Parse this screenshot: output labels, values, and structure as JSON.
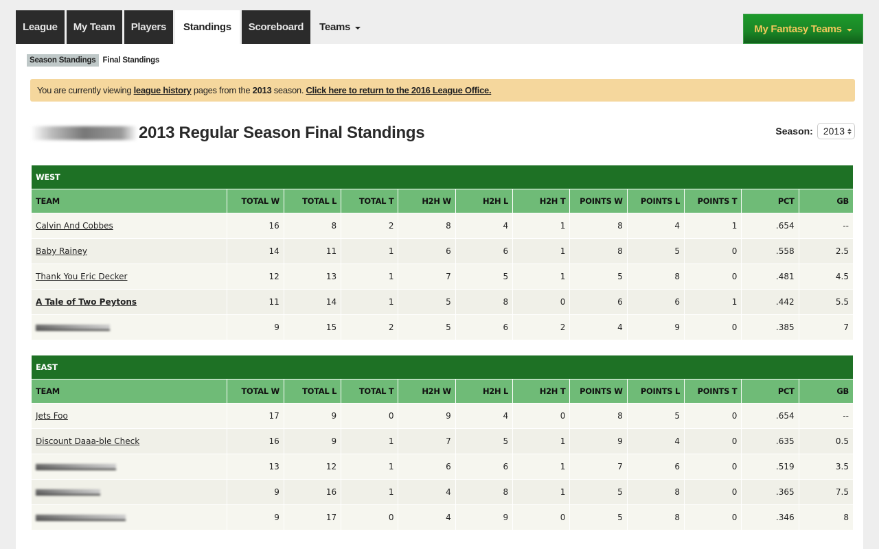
{
  "nav": {
    "tabs": [
      {
        "label": "League",
        "active": false
      },
      {
        "label": "My Team",
        "active": false
      },
      {
        "label": "Players",
        "active": false
      },
      {
        "label": "Standings",
        "active": true
      },
      {
        "label": "Scoreboard",
        "active": false
      }
    ],
    "teams_menu": "Teams",
    "my_fantasy_teams": "My Fantasy Teams"
  },
  "subnav": {
    "season_standings": "Season Standings",
    "final_standings": "Final Standings"
  },
  "notice": {
    "prefix": "You are currently viewing ",
    "link1": "league history",
    "middle": " pages from the ",
    "year": "2013",
    "suffix": " season. ",
    "link2": "Click here to return to the 2016 League Office."
  },
  "header": {
    "title": "2013 Regular Season Final Standings",
    "season_label": "Season:",
    "season_value": "2013"
  },
  "columns": [
    "TEAM",
    "TOTAL W",
    "TOTAL L",
    "TOTAL T",
    "H2H W",
    "H2H L",
    "H2H T",
    "POINTS W",
    "POINTS L",
    "POINTS T",
    "PCT",
    "GB"
  ],
  "divisions": [
    {
      "name": "WEST",
      "rows": [
        {
          "team": "Calvin And Cobbes",
          "redacted": false,
          "bold": false,
          "values": [
            "16",
            "8",
            "2",
            "8",
            "4",
            "1",
            "8",
            "4",
            "1",
            ".654",
            "--"
          ]
        },
        {
          "team": "Baby Rainey",
          "redacted": false,
          "bold": false,
          "values": [
            "14",
            "11",
            "1",
            "6",
            "6",
            "1",
            "8",
            "5",
            "0",
            ".558",
            "2.5"
          ]
        },
        {
          "team": "Thank You Eric Decker",
          "redacted": false,
          "bold": false,
          "values": [
            "12",
            "13",
            "1",
            "7",
            "5",
            "1",
            "5",
            "8",
            "0",
            ".481",
            "4.5"
          ]
        },
        {
          "team": "A Tale of Two Peytons",
          "redacted": false,
          "bold": true,
          "values": [
            "11",
            "14",
            "1",
            "5",
            "8",
            "0",
            "6",
            "6",
            "1",
            ".442",
            "5.5"
          ]
        },
        {
          "team": "",
          "redacted": true,
          "bold": false,
          "values": [
            "9",
            "15",
            "2",
            "5",
            "6",
            "2",
            "4",
            "9",
            "0",
            ".385",
            "7"
          ]
        }
      ]
    },
    {
      "name": "EAST",
      "rows": [
        {
          "team": "Jets Foo",
          "redacted": false,
          "bold": false,
          "values": [
            "17",
            "9",
            "0",
            "9",
            "4",
            "0",
            "8",
            "5",
            "0",
            ".654",
            "--"
          ]
        },
        {
          "team": "Discount Daaa-ble Check",
          "redacted": false,
          "bold": false,
          "values": [
            "16",
            "9",
            "1",
            "7",
            "5",
            "1",
            "9",
            "4",
            "0",
            ".635",
            "0.5"
          ]
        },
        {
          "team": "",
          "redacted": true,
          "bold": false,
          "values": [
            "13",
            "12",
            "1",
            "6",
            "6",
            "1",
            "7",
            "6",
            "0",
            ".519",
            "3.5"
          ]
        },
        {
          "team": "",
          "redacted": true,
          "bold": false,
          "values": [
            "9",
            "16",
            "1",
            "4",
            "8",
            "1",
            "5",
            "8",
            "0",
            ".365",
            "7.5"
          ]
        },
        {
          "team": "",
          "redacted": true,
          "bold": false,
          "values": [
            "9",
            "17",
            "0",
            "4",
            "9",
            "0",
            "5",
            "8",
            "0",
            ".346",
            "8"
          ]
        }
      ]
    }
  ]
}
